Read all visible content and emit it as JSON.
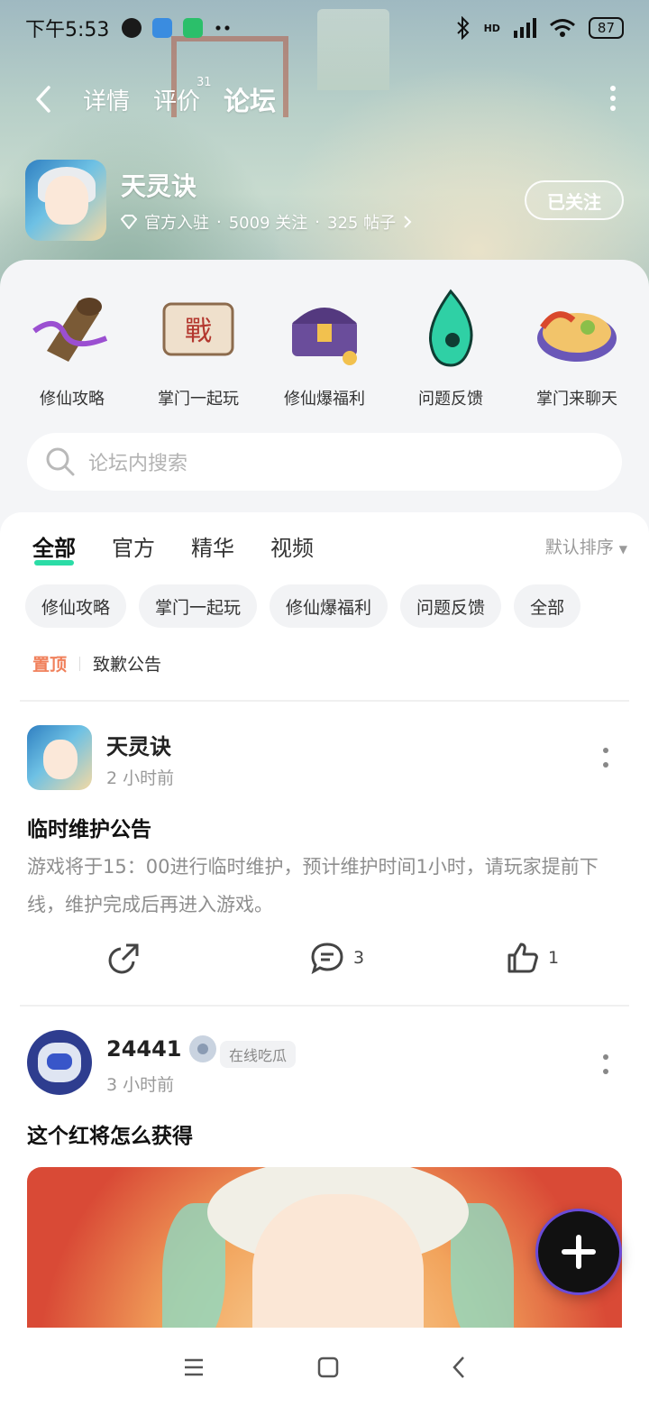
{
  "status_bar": {
    "time": "下午5:53",
    "battery": "87",
    "signal_label": "HD"
  },
  "nav": {
    "tabs": [
      {
        "label": "详情"
      },
      {
        "label": "评价",
        "badge": "31"
      },
      {
        "label": "论坛"
      }
    ],
    "active_tab": "论坛"
  },
  "game": {
    "name": "天灵诀",
    "official": "官方入驻",
    "followers": "5009 关注",
    "posts": "325 帖子",
    "follow_button": "已关注"
  },
  "categories": [
    {
      "label": "修仙攻略",
      "icon": "horn-icon"
    },
    {
      "label": "掌门一起玩",
      "icon": "scroll-icon"
    },
    {
      "label": "修仙爆福利",
      "icon": "treasure-chest-icon"
    },
    {
      "label": "问题反馈",
      "icon": "flame-icon"
    },
    {
      "label": "掌门来聊天",
      "icon": "food-plate-icon"
    }
  ],
  "search": {
    "placeholder": "论坛内搜索"
  },
  "feed_tabs": [
    {
      "label": "全部"
    },
    {
      "label": "官方"
    },
    {
      "label": "精华"
    },
    {
      "label": "视频"
    }
  ],
  "sort_label": "默认排序",
  "chips": [
    "修仙攻略",
    "掌门一起玩",
    "修仙爆福利",
    "问题反馈",
    "全部"
  ],
  "pinned": {
    "tag": "置顶",
    "title": "致歉公告"
  },
  "posts": [
    {
      "author": "天灵诀",
      "time": "2 小时前",
      "title": "临时维护公告",
      "body": "游戏将于15：00进行临时维护，预计维护时间1小时，请玩家提前下线，维护完成后再进入游戏。",
      "comments": "3",
      "likes": "1"
    },
    {
      "author": "24441",
      "badge": "在线吃瓜",
      "time": "3 小时前",
      "title": "这个红将怎么获得"
    }
  ],
  "colors": {
    "accent": "#2bdca6",
    "pinned_tag": "#f0805b"
  }
}
